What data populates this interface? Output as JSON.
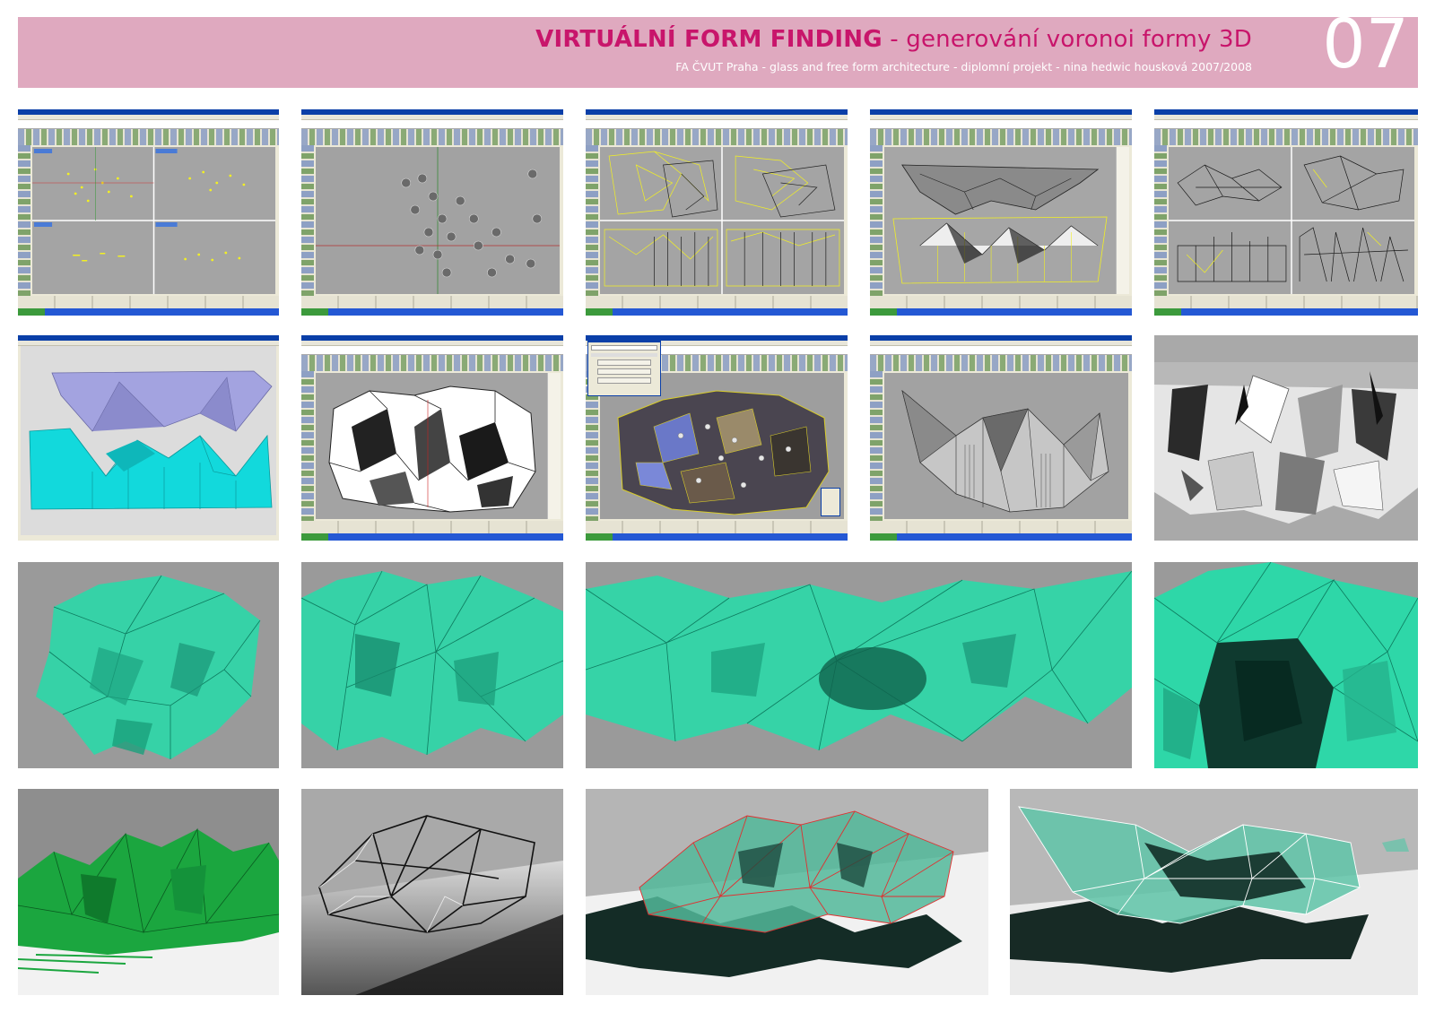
{
  "header": {
    "title_main": "VIRTUÁLNÍ FORM FINDING",
    "title_rest": " - generování voronoi formy 3D",
    "subtitle": "FA ČVUT Praha - glass and free form architecture  - diplomní projekt - nina hedwic housková 2007/2008",
    "page_number": "07"
  },
  "colors": {
    "header_bg": "#dfa9bf",
    "title": "#c8156b",
    "teal": "#2ed7a8",
    "green": "#1ba63f",
    "yellow": "#f2f023",
    "cyan": "#12d9dc"
  }
}
